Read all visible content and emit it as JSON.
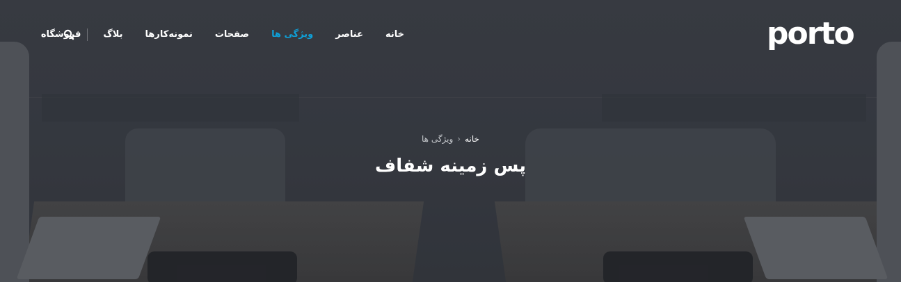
{
  "logo": {
    "text": "porto"
  },
  "nav": {
    "items": [
      {
        "label": "خانه",
        "active": false
      },
      {
        "label": "عناصر",
        "active": false
      },
      {
        "label": "ویژگی ها",
        "active": true
      },
      {
        "label": "صفحات",
        "active": false
      },
      {
        "label": "نمونه‌کارها",
        "active": false
      },
      {
        "label": "بلاگ",
        "active": false
      },
      {
        "label": "فروشگاه",
        "active": false
      }
    ],
    "search_icon": "search-icon",
    "active_color": "#0ea0d8"
  },
  "breadcrumb": {
    "home": "خانه",
    "separator_icon": "chevron-left-icon",
    "current": "ویژگی ها"
  },
  "page": {
    "title": "پس زمینه شفاف"
  }
}
